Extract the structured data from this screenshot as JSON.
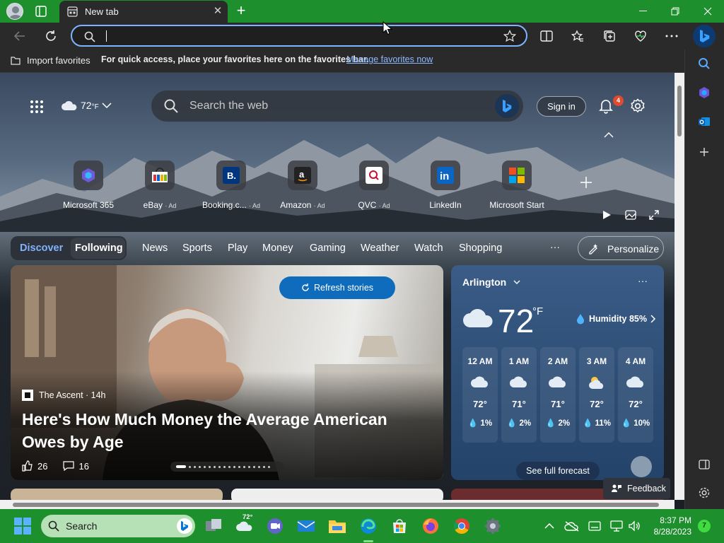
{
  "browser": {
    "tab_title": "New tab",
    "address_value": ""
  },
  "favorites_bar": {
    "import_label": "Import favorites",
    "message": "For quick access, place your favorites here on the favorites bar.",
    "manage_link": "Manage favorites now"
  },
  "newtab": {
    "weather_temp": "72",
    "weather_unit": "°F",
    "search_placeholder": "Search the web",
    "sign_in": "Sign in",
    "notification_count": "4"
  },
  "quick_links": [
    {
      "label": "Microsoft 365",
      "ad": "",
      "icon": "microsoft365-icon"
    },
    {
      "label": "eBay",
      "ad": "· Ad",
      "icon": "ebay-icon"
    },
    {
      "label": "Booking.c...",
      "ad": "· Ad",
      "icon": "booking-icon"
    },
    {
      "label": "Amazon",
      "ad": "· Ad",
      "icon": "amazon-icon"
    },
    {
      "label": "QVC",
      "ad": "· Ad",
      "icon": "qvc-icon"
    },
    {
      "label": "LinkedIn",
      "ad": "",
      "icon": "linkedin-icon"
    },
    {
      "label": "Microsoft Start",
      "ad": "",
      "icon": "microsoft-start-icon"
    }
  ],
  "feed_nav": {
    "discover": "Discover",
    "following": "Following",
    "categories": [
      "News",
      "Sports",
      "Play",
      "Money",
      "Gaming",
      "Weather",
      "Watch",
      "Shopping"
    ],
    "more": "···",
    "personalize": "Personalize"
  },
  "hero": {
    "refresh": "Refresh stories",
    "source": "The Ascent · 14h",
    "headline": "Here's How Much Money the Average American Owes by Age",
    "likes": "26",
    "comments": "16"
  },
  "weather_card": {
    "location": "Arlington",
    "temp": "72",
    "unit": "°F",
    "humidity": "Humidity 85%",
    "hourly": [
      {
        "time": "12 AM",
        "temp": "72°",
        "precip": "1%",
        "icon": "cloud-icon"
      },
      {
        "time": "1 AM",
        "temp": "71°",
        "precip": "2%",
        "icon": "cloud-icon"
      },
      {
        "time": "2 AM",
        "temp": "71°",
        "precip": "2%",
        "icon": "cloud-icon"
      },
      {
        "time": "3 AM",
        "temp": "72°",
        "precip": "11%",
        "icon": "partly-cloudy-icon"
      },
      {
        "time": "4 AM",
        "temp": "72°",
        "precip": "10%",
        "icon": "cloud-icon"
      }
    ],
    "forecast_button": "See full forecast"
  },
  "feedback": "Feedback",
  "taskbar": {
    "search_placeholder": "Search",
    "weather_temp": "72°",
    "time": "8:37 PM",
    "date": "8/28/2023",
    "notification_count": "7"
  },
  "colors": {
    "titlebar": "#1d8f2d",
    "accent": "#0f6cbd",
    "link": "#8cb8ff"
  }
}
